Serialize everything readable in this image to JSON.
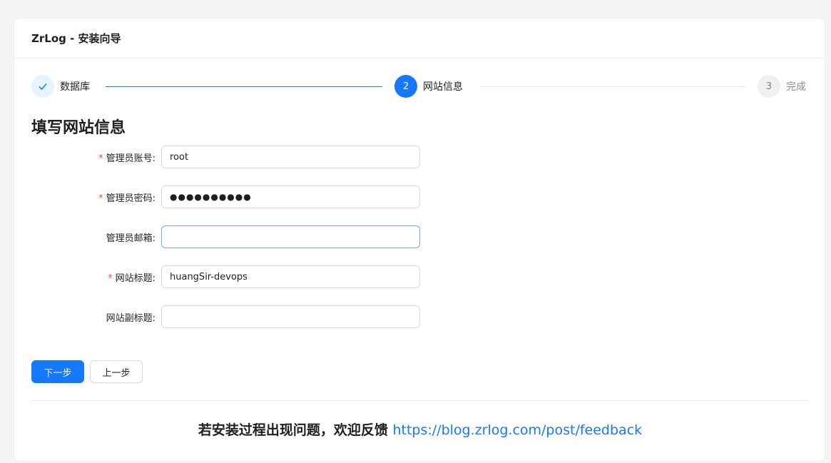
{
  "header": {
    "title": "ZrLog - 安装向导"
  },
  "steps": [
    {
      "index": "✓",
      "label": "数据库",
      "status": "finish"
    },
    {
      "index": "2",
      "label": "网站信息",
      "status": "process"
    },
    {
      "index": "3",
      "label": "完成",
      "status": "wait"
    }
  ],
  "form": {
    "title": "填写网站信息",
    "fields": [
      {
        "label": "管理员账号:",
        "required": true,
        "value": "root",
        "placeholder": ""
      },
      {
        "label": "管理员密码:",
        "required": true,
        "value": "●●●●●●●●●●",
        "placeholder": ""
      },
      {
        "label": "管理员邮箱:",
        "required": false,
        "value": "",
        "placeholder": ""
      },
      {
        "label": "网站标题:",
        "required": true,
        "value": "huangSir-devops",
        "placeholder": ""
      },
      {
        "label": "网站副标题:",
        "required": false,
        "value": "",
        "placeholder": ""
      }
    ],
    "required_mark": "*"
  },
  "buttons": {
    "next": "下一步",
    "prev": "上一步"
  },
  "footer": {
    "text": "若安装过程出现问题，欢迎反馈",
    "link": "https://blog.zrlog.com/post/feedback"
  },
  "colors": {
    "primary": "#1677ff",
    "required": "#ff4d4f"
  }
}
